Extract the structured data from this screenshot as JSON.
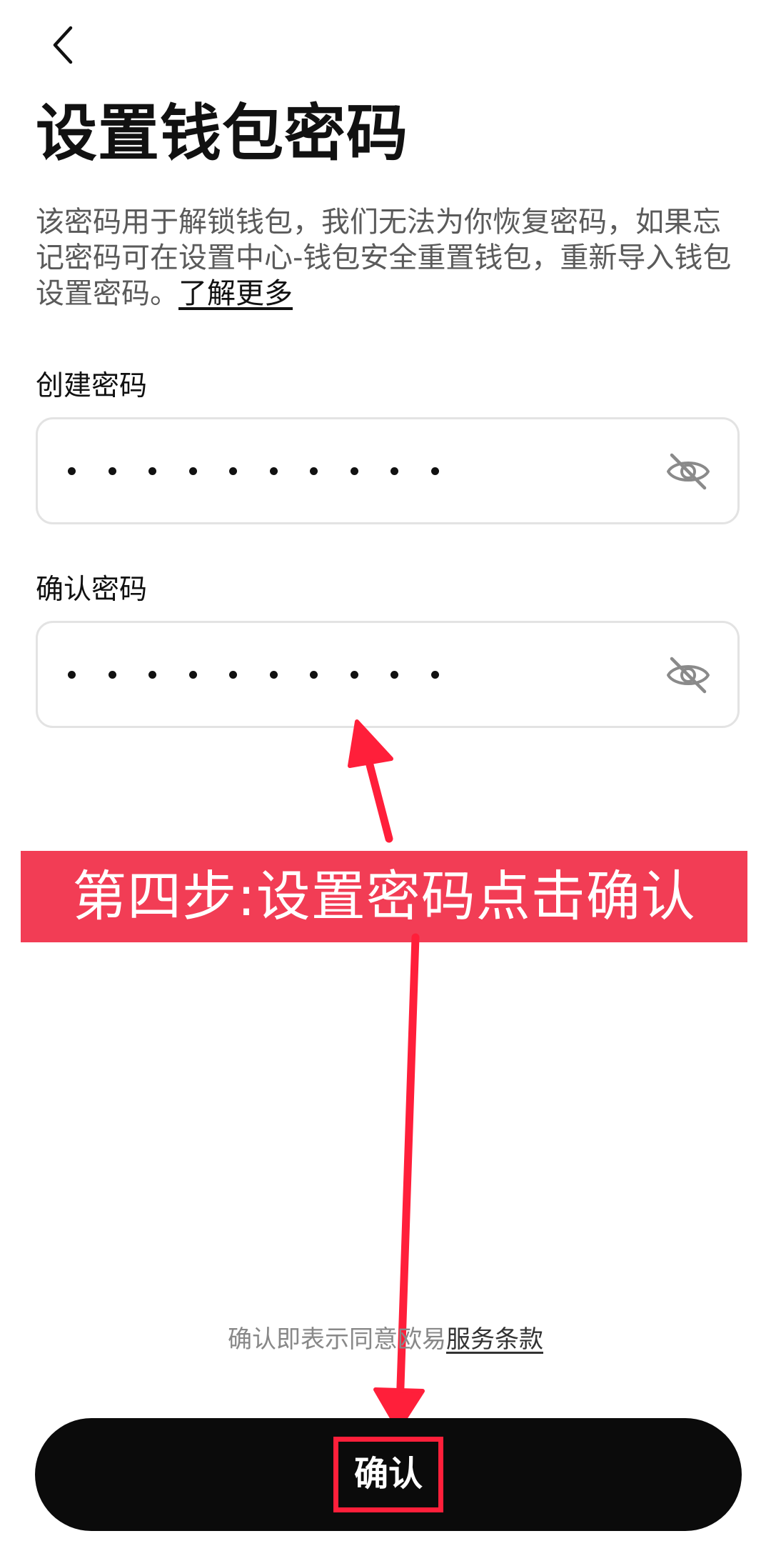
{
  "header": {
    "back_icon": "chevron-left-icon",
    "title": "设置钱包密码"
  },
  "description": {
    "text": "该密码用于解锁钱包，我们无法为你恢复密码，如果忘记密码可在设置中心-钱包安全重置钱包，重新导入钱包设置密码。",
    "learn_more": "了解更多"
  },
  "form": {
    "create_label": "创建密码",
    "confirm_label": "确认密码",
    "visibility_icon": "eye-off-icon",
    "masked_chars": 10
  },
  "annotation": {
    "banner_text": "第四步:设置密码点击确认",
    "banner_color": "#f23d55",
    "arrow_color": "#ff1f3a"
  },
  "footer": {
    "terms_prefix": "确认即表示同意欧易",
    "terms_link": "服务条款",
    "confirm_button": "确认"
  }
}
